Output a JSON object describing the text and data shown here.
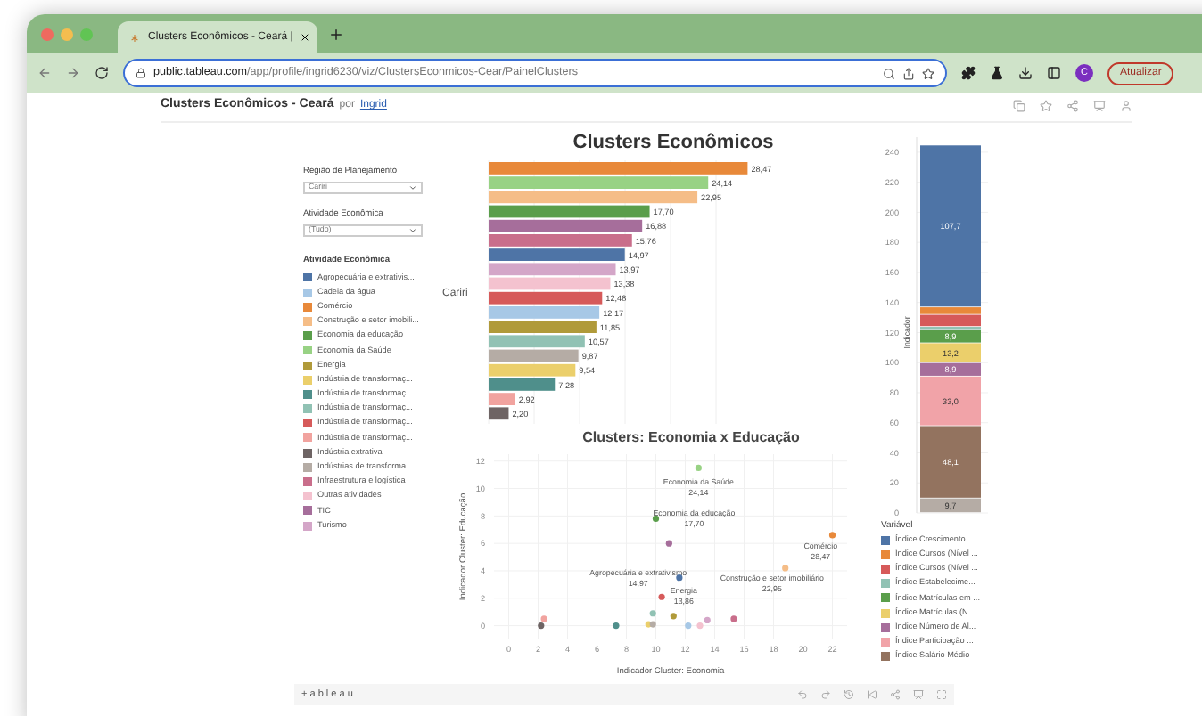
{
  "browser": {
    "tab_title": "Clusters Econômicos - Ceará |",
    "url_domain": "public.tableau.com",
    "url_path": "/app/profile/ingrid6230/viz/ClustersEconmicos-Cear/PainelClusters",
    "profile_initial": "C",
    "update_button": "Atualizar"
  },
  "page_header": {
    "title": "Clusters Econômicos - Ceará",
    "by": "por",
    "author": "Ingrid"
  },
  "filters": [
    {
      "label": "Região de Planejamento",
      "value": "Cariri"
    },
    {
      "label": "Atividade Econômica",
      "value": "(Tudo)"
    }
  ],
  "activity_legend": {
    "title": "Atividade Econômica",
    "items": [
      {
        "label": "Agropecuária e extrativis...",
        "color": "#4e74a6"
      },
      {
        "label": "Cadeia da água",
        "color": "#a7c8e6"
      },
      {
        "label": "Comércio",
        "color": "#e8893a"
      },
      {
        "label": "Construção e setor imobili...",
        "color": "#f5bd87"
      },
      {
        "label": "Economia da educação",
        "color": "#5a9e4b"
      },
      {
        "label": "Economia da Saúde",
        "color": "#98d284"
      },
      {
        "label": "Energia",
        "color": "#b09a3a"
      },
      {
        "label": "Indústria de transformaç...",
        "color": "#ebcf6b"
      },
      {
        "label": "Indústria de transformaç...",
        "color": "#4f8f8b"
      },
      {
        "label": "Indústria de transformaç...",
        "color": "#91c2b4"
      },
      {
        "label": "Indústria de transformaç...",
        "color": "#d65a5a"
      },
      {
        "label": "Indústria de transformaç...",
        "color": "#f1a39f"
      },
      {
        "label": "Indústria extrativa",
        "color": "#6e6464"
      },
      {
        "label": "Indústrias de transforma...",
        "color": "#b5aca5"
      },
      {
        "label": "Infraestrutura e logística",
        "color": "#c96e8b"
      },
      {
        "label": "Outras atividades",
        "color": "#f4c2cf"
      },
      {
        "label": "TIC",
        "color": "#a66e9b"
      },
      {
        "label": "Turismo",
        "color": "#d4a6c8"
      }
    ]
  },
  "bar_chart": {
    "row_label": "Cariri",
    "chart_data": {
      "type": "bar",
      "title": "Clusters Econômicos",
      "orientation": "horizontal",
      "grid": true,
      "value_labels": [
        "28,47",
        "24,14",
        "22,95",
        "17,70",
        "16,88",
        "15,76",
        "14,97",
        "13,97",
        "13,38",
        "12,48",
        "12,17",
        "11,85",
        "10,57",
        "9,87",
        "9,54",
        "7,28",
        "2,92",
        "2,20"
      ],
      "values": [
        28.47,
        24.14,
        22.95,
        17.7,
        16.88,
        15.76,
        14.97,
        13.97,
        13.38,
        12.48,
        12.17,
        11.85,
        10.57,
        9.87,
        9.54,
        7.28,
        2.92,
        2.2
      ],
      "colors": [
        "#e8893a",
        "#98d284",
        "#f5bd87",
        "#5a9e4b",
        "#a66e9b",
        "#c96e8b",
        "#4e74a6",
        "#d4a6c8",
        "#f4c2cf",
        "#d65a5a",
        "#a7c8e6",
        "#b09a3a",
        "#91c2b4",
        "#b5aca5",
        "#ebcf6b",
        "#4f8f8b",
        "#f1a39f",
        "#6e6464"
      ]
    }
  },
  "scatter": {
    "chart_data": {
      "type": "scatter",
      "title": "Clusters: Economia x Educação",
      "xlabel": "Indicador Cluster: Economia",
      "ylabel": "Indicador Cluster: Educação",
      "grid": true,
      "xlim": [
        -1,
        23
      ],
      "ylim": [
        -1,
        12.5
      ],
      "xticks": [
        0,
        2,
        4,
        6,
        8,
        10,
        12,
        14,
        16,
        18,
        20,
        22
      ],
      "yticks": [
        0,
        2,
        4,
        6,
        8,
        10,
        12
      ],
      "x": [
        12.9,
        10,
        10.9,
        22,
        18.8,
        11.6,
        10.4,
        11.2,
        9.8,
        2.2,
        2.4,
        7.3,
        9.5,
        9.8,
        12.2,
        13,
        13.5,
        15.3
      ],
      "series": [
        {
          "color": "#98d284",
          "values": [
            11.5,
            null,
            null,
            null,
            null,
            null,
            null,
            null,
            null,
            null,
            null,
            null,
            null,
            null,
            null,
            null,
            null,
            null
          ]
        },
        {
          "color": "#5a9e4b",
          "values": [
            null,
            7.8,
            null,
            null,
            null,
            null,
            null,
            null,
            null,
            null,
            null,
            null,
            null,
            null,
            null,
            null,
            null,
            null
          ]
        },
        {
          "color": "#a66e9b",
          "values": [
            null,
            null,
            6,
            null,
            null,
            null,
            null,
            null,
            null,
            null,
            null,
            null,
            null,
            null,
            null,
            null,
            null,
            null
          ]
        },
        {
          "color": "#e8893a",
          "values": [
            null,
            null,
            null,
            6.6,
            null,
            null,
            null,
            null,
            null,
            null,
            null,
            null,
            null,
            null,
            null,
            null,
            null,
            null
          ]
        },
        {
          "color": "#f5bd87",
          "values": [
            null,
            null,
            null,
            null,
            4.2,
            null,
            null,
            null,
            null,
            null,
            null,
            null,
            null,
            null,
            null,
            null,
            null,
            null
          ]
        },
        {
          "color": "#4e74a6",
          "values": [
            null,
            null,
            null,
            null,
            null,
            3.5,
            null,
            null,
            null,
            null,
            null,
            null,
            null,
            null,
            null,
            null,
            null,
            null
          ]
        },
        {
          "color": "#d65a5a",
          "values": [
            null,
            null,
            null,
            null,
            null,
            null,
            2.1,
            null,
            null,
            null,
            null,
            null,
            null,
            null,
            null,
            null,
            null,
            null
          ]
        },
        {
          "color": "#b09a3a",
          "values": [
            null,
            null,
            null,
            null,
            null,
            null,
            null,
            0.7,
            null,
            null,
            null,
            null,
            null,
            null,
            null,
            null,
            null,
            null
          ]
        },
        {
          "color": "#91c2b4",
          "values": [
            null,
            null,
            null,
            null,
            null,
            null,
            null,
            null,
            0.9,
            null,
            null,
            null,
            null,
            null,
            null,
            null,
            null,
            null
          ]
        },
        {
          "color": "#6e6464",
          "values": [
            null,
            null,
            null,
            null,
            null,
            null,
            null,
            null,
            null,
            0,
            null,
            null,
            null,
            null,
            null,
            null,
            null,
            null
          ]
        },
        {
          "color": "#f1a39f",
          "values": [
            null,
            null,
            null,
            null,
            null,
            null,
            null,
            null,
            null,
            null,
            0.5,
            null,
            null,
            null,
            null,
            null,
            null,
            null
          ]
        },
        {
          "color": "#4f8f8b",
          "values": [
            null,
            null,
            null,
            null,
            null,
            null,
            null,
            null,
            null,
            null,
            null,
            0,
            null,
            null,
            null,
            null,
            null,
            null
          ]
        },
        {
          "color": "#ebcf6b",
          "values": [
            null,
            null,
            null,
            null,
            null,
            null,
            null,
            null,
            null,
            null,
            null,
            null,
            0.1,
            null,
            null,
            null,
            null,
            null
          ]
        },
        {
          "color": "#b5aca5",
          "values": [
            null,
            null,
            null,
            null,
            null,
            null,
            null,
            null,
            null,
            null,
            null,
            null,
            null,
            0.1,
            null,
            null,
            null,
            null
          ]
        },
        {
          "color": "#a7c8e6",
          "values": [
            null,
            null,
            null,
            null,
            null,
            null,
            null,
            null,
            null,
            null,
            null,
            null,
            null,
            null,
            0,
            null,
            null,
            null
          ]
        },
        {
          "color": "#f4c2cf",
          "values": [
            null,
            null,
            null,
            null,
            null,
            null,
            null,
            null,
            null,
            null,
            null,
            null,
            null,
            null,
            null,
            0,
            null,
            null
          ]
        },
        {
          "color": "#d4a6c8",
          "values": [
            null,
            null,
            null,
            null,
            null,
            null,
            null,
            null,
            null,
            null,
            null,
            null,
            null,
            null,
            null,
            null,
            0.4,
            null
          ]
        },
        {
          "color": "#c96e8b",
          "values": [
            null,
            null,
            null,
            null,
            null,
            null,
            null,
            null,
            null,
            null,
            null,
            null,
            null,
            null,
            null,
            null,
            null,
            0.5
          ]
        }
      ],
      "annotations": [
        "Economia da Saúde\n24,14",
        "Economia da educação\n17,70",
        "Comércio\n28,47",
        "Construção e setor imobiliário\n22,95",
        "Agropecuária e extrativismo\n14,97",
        "Energia\n13,86"
      ]
    }
  },
  "stacked_chart": {
    "chart_data": {
      "type": "bar",
      "stacked": true,
      "ylabel": "Indicador",
      "grid": true,
      "ylim": [
        0,
        250
      ],
      "yticks": [
        0,
        20,
        40,
        60,
        80,
        100,
        120,
        140,
        160,
        180,
        200,
        220,
        240
      ],
      "value_labels": [
        "9,7",
        "48,1",
        "33,0",
        "8,9",
        "13,2",
        "8,9",
        null,
        null,
        null,
        "107,7"
      ],
      "series": [
        {
          "color": "#b5aca5",
          "values": [
            9.7
          ]
        },
        {
          "color": "#93735f",
          "values": [
            48.1
          ]
        },
        {
          "color": "#f1a3a8",
          "values": [
            33.0
          ]
        },
        {
          "color": "#a66e9b",
          "values": [
            8.9
          ]
        },
        {
          "color": "#ebcf6b",
          "values": [
            13.2
          ]
        },
        {
          "color": "#5a9e4b",
          "values": [
            8.9
          ]
        },
        {
          "color": "#91c2b4",
          "values": [
            2
          ]
        },
        {
          "color": "#d65a5a",
          "values": [
            8
          ]
        },
        {
          "color": "#e8893a",
          "values": [
            5
          ]
        },
        {
          "color": "#4e74a6",
          "values": [
            107.7
          ]
        }
      ]
    }
  },
  "variable_legend": {
    "title": "Variável",
    "items": [
      {
        "label": "Índice Crescimento ...",
        "color": "#4e74a6"
      },
      {
        "label": "Índice Cursos (Nível ...",
        "color": "#e8893a"
      },
      {
        "label": "Índice Cursos (Nível ...",
        "color": "#d65a5a"
      },
      {
        "label": "Índice Estabelecime...",
        "color": "#91c2b4"
      },
      {
        "label": "Índice Matrículas em ...",
        "color": "#5a9e4b"
      },
      {
        "label": "Índice Matrículas (N...",
        "color": "#ebcf6b"
      },
      {
        "label": "Índice Número de Al...",
        "color": "#a66e9b"
      },
      {
        "label": "Índice Participação ...",
        "color": "#f1a3a8"
      },
      {
        "label": "Índice Salário Médio",
        "color": "#93735f"
      }
    ]
  },
  "footer": {
    "logo": "+ a b l e a u"
  }
}
